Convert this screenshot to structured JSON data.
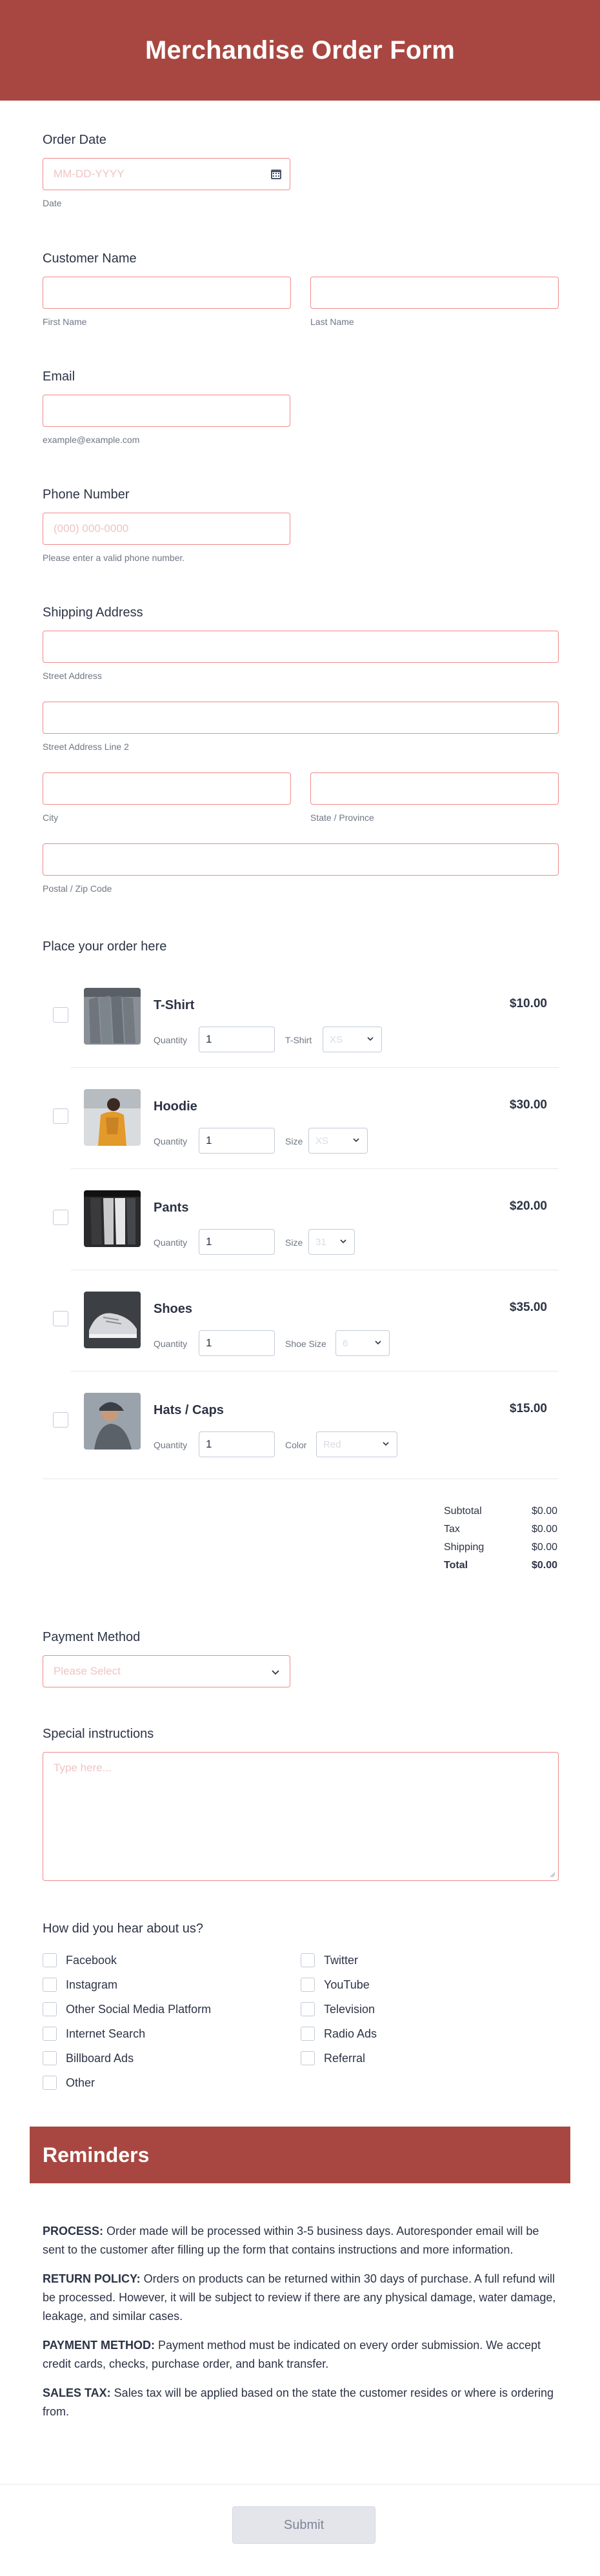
{
  "header": {
    "title": "Merchandise Order Form"
  },
  "order_date": {
    "label": "Order Date",
    "placeholder": "MM-DD-YYYY",
    "sub": "Date"
  },
  "customer_name": {
    "label": "Customer Name",
    "first_sub": "First Name",
    "last_sub": "Last Name"
  },
  "email": {
    "label": "Email",
    "sub": "example@example.com"
  },
  "phone": {
    "label": "Phone Number",
    "placeholder": "(000) 000-0000",
    "sub": "Please enter a valid phone number."
  },
  "shipping": {
    "label": "Shipping Address",
    "street1": "Street Address",
    "street2": "Street Address Line 2",
    "city": "City",
    "state": "State / Province",
    "zip": "Postal / Zip Code"
  },
  "order": {
    "label": "Place your order here",
    "quantity_label": "Quantity",
    "products": [
      {
        "name": "T-Shirt",
        "price": "$10.00",
        "qty": "1",
        "option_label": "T-Shirt",
        "option_value": "XS"
      },
      {
        "name": "Hoodie",
        "price": "$30.00",
        "qty": "1",
        "option_label": "Size",
        "option_value": "XS"
      },
      {
        "name": "Pants",
        "price": "$20.00",
        "qty": "1",
        "option_label": "Size",
        "option_value": "31"
      },
      {
        "name": "Shoes",
        "price": "$35.00",
        "qty": "1",
        "option_label": "Shoe Size",
        "option_value": "6"
      },
      {
        "name": "Hats / Caps",
        "price": "$15.00",
        "qty": "1",
        "option_label": "Color",
        "option_value": "Red"
      }
    ],
    "totals": [
      {
        "label": "Subtotal",
        "value": "$0.00"
      },
      {
        "label": "Tax",
        "value": "$0.00"
      },
      {
        "label": "Shipping",
        "value": "$0.00"
      },
      {
        "label": "Total",
        "value": "$0.00"
      }
    ]
  },
  "payment": {
    "label": "Payment Method",
    "placeholder": "Please Select"
  },
  "instructions": {
    "label": "Special instructions",
    "placeholder": "Type here..."
  },
  "hear": {
    "label": "How did you hear about us?",
    "options": [
      "Facebook",
      "Twitter",
      "Instagram",
      "YouTube",
      "Other Social Media Platform",
      "Television",
      "Internet Search",
      "Radio Ads",
      "Billboard Ads",
      "Referral",
      "Other"
    ]
  },
  "reminders": {
    "title": "Reminders",
    "items": [
      {
        "head": "PROCESS:",
        "text": " Order made will be processed within 3-5 business days. Autoresponder email will be sent to the customer after filling up the form that contains instructions and more information."
      },
      {
        "head": "RETURN POLICY:",
        "text": " Orders on products can be returned within 30 days of purchase. A full refund will be processed. However, it will be subject to review if there are any physical damage, water damage, leakage, and similar cases."
      },
      {
        "head": "PAYMENT METHOD:",
        "text": " Payment method must be indicated on every order submission. We accept credit cards, checks, purchase order, and bank transfer."
      },
      {
        "head": "SALES TAX:",
        "text": " Sales tax will be applied based on the state the customer resides or where is ordering from."
      }
    ]
  },
  "submit": {
    "label": "Submit"
  },
  "colors": {
    "brand": "#a84741",
    "field_border": "#f08a8a",
    "text": "#2c3345"
  }
}
